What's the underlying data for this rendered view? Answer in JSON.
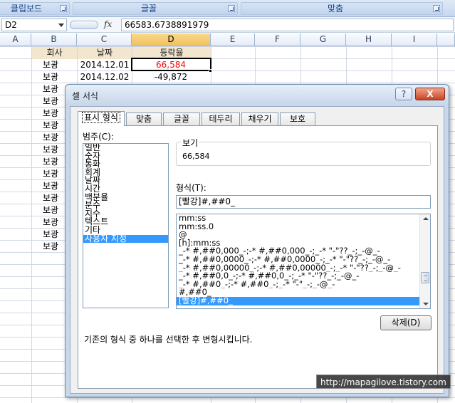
{
  "ribbon": {
    "groups": [
      {
        "label": "클립보드"
      },
      {
        "label": "글꼴"
      },
      {
        "label": "맞춤"
      }
    ]
  },
  "formula_bar": {
    "name_box": "D2",
    "fx_label": "fx",
    "value": "66583.6738891979"
  },
  "columns": [
    "A",
    "B",
    "C",
    "D",
    "E",
    "F",
    "G",
    "H",
    "I"
  ],
  "selected_column": "D",
  "sheet": {
    "headers": {
      "b": "회사",
      "c": "날짜",
      "d": "등락율"
    },
    "rows": [
      {
        "b": "보광",
        "c": "2014.12.01",
        "d": "66,584"
      },
      {
        "b": "보광",
        "c": "2014.12.02",
        "d": "-49,872"
      },
      {
        "b": "보광"
      },
      {
        "b": "보광"
      },
      {
        "b": "보광"
      },
      {
        "b": "보광"
      },
      {
        "b": "보광"
      },
      {
        "b": "보광"
      },
      {
        "b": "보광"
      },
      {
        "b": "보광"
      },
      {
        "b": "보광"
      },
      {
        "b": "보광"
      },
      {
        "b": "보광"
      },
      {
        "b": "보광"
      },
      {
        "b": "보광"
      },
      {
        "b": "보광"
      }
    ],
    "colors": {
      "negative_red": "#ff0000",
      "header_fill": "#f2e6cf"
    }
  },
  "dialog": {
    "title": "셀 서식",
    "help_label": "?",
    "close_label": "X",
    "tabs": [
      "표시 형식",
      "맞춤",
      "글꼴",
      "테두리",
      "채우기",
      "보호"
    ],
    "category_label": "범주(C):",
    "categories": [
      "일반",
      "숫자",
      "통화",
      "회계",
      "날짜",
      "시간",
      "백분율",
      "분수",
      "지수",
      "텍스트",
      "기타",
      "사용자 지정"
    ],
    "selected_category": "사용자 지정",
    "sample_label": "보기",
    "sample_value": "66,584",
    "type_label": "형식(T):",
    "type_value": "[빨강]#,##0_",
    "formats": [
      "mm:ss",
      "mm:ss.0",
      "@",
      "[h]:mm:ss",
      "_-* #,##0,000_-;-* #,##0,000_-;_-* \"-\"??_-;_-@_-",
      "_-* #,##0,0000_-;-* #,##0,0000_-;_-* \"-\"??_-;_-@_-",
      "_-* #,##0,00000_-;-* #,##0,00000_-;_-* \"-\"??_-;_-@_-",
      "_-* #,##0,0_-;-* #,##0,0_-;_-* \"-\"??_-;_-@_-",
      "_-* #,##0_-;-* #,##0_-;_-* \"-\"_-;_-@_-",
      "#,##0_",
      "[빨강]#,##0_"
    ],
    "delete_label": "삭제(D)",
    "description": "기존의 형식 중 하나를 선택한 후 변형시킵니다."
  },
  "watermark": "http://mapagilove.tistory.com"
}
